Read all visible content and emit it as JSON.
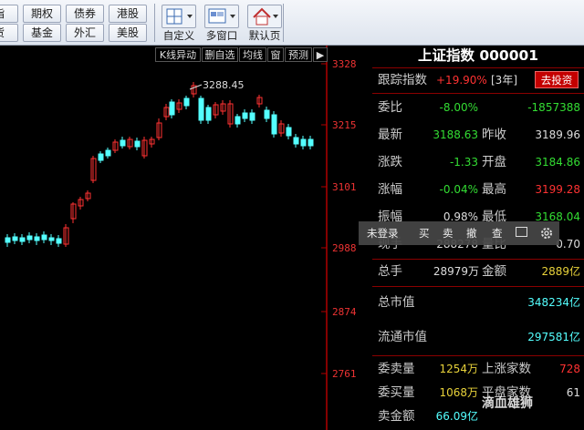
{
  "toolbar": {
    "row1": [
      "指",
      "期权",
      "债券",
      "港股"
    ],
    "row2": [
      "货",
      "基金",
      "外汇",
      "美股"
    ],
    "tools": [
      {
        "icon": "customize-grid-icon",
        "label": "自定义"
      },
      {
        "icon": "multi-window-icon",
        "label": "多窗口"
      },
      {
        "icon": "home-icon",
        "label": "默认页"
      }
    ]
  },
  "chart_tabs": [
    "K线异动",
    "删自选",
    "均线",
    "窗",
    "预测"
  ],
  "chart_tab_arrow": "▶",
  "chart_data": {
    "type": "candlestick",
    "y_ticks": [
      "3328",
      "3215",
      "3101",
      "2988",
      "2874",
      "2761"
    ],
    "ylim": [
      2761,
      3328
    ],
    "annotation": "3288.45",
    "up_color": "#ff3232",
    "down_color": "#54ffff"
  },
  "panel": {
    "title": "上证指数 000001",
    "track_label": "跟踪指数",
    "track_value": "+19.90%",
    "track_period": "[3年]",
    "invest_button": "去投资",
    "rows": [
      {
        "l1": "委比",
        "v1": "-8.00%",
        "c1": "#33dd33",
        "l2": "",
        "v2": "-1857388",
        "c2": "#33dd33"
      },
      {
        "l1": "最新",
        "v1": "3188.63",
        "c1": "#33dd33",
        "l2": "昨收",
        "v2": "3189.96",
        "c2": "#dddddd"
      },
      {
        "l1": "涨跌",
        "v1": "-1.33",
        "c1": "#33dd33",
        "l2": "开盘",
        "v2": "3184.86",
        "c2": "#33dd33"
      },
      {
        "l1": "涨幅",
        "v1": "-0.04%",
        "c1": "#33dd33",
        "l2": "最高",
        "v2": "3199.28",
        "c2": "#ff3232"
      },
      {
        "l1": "振幅",
        "v1": "0.98%",
        "c1": "#dddddd",
        "l2": "最低",
        "v2": "3168.04",
        "c2": "#33dd33"
      },
      {
        "l1": "现手",
        "v1": "288278",
        "c1": "#dddddd",
        "l2": "量比",
        "v2": "0.70",
        "c2": "#dddddd"
      }
    ],
    "total_hands_label": "总手",
    "total_hands_value": "28979万",
    "amount_label": "金额",
    "amount_value": "2889亿",
    "mcap_label": "总市值",
    "mcap_value": "348234亿",
    "float_label": "流通市值",
    "float_value": "297581亿",
    "sell_vol_label": "委卖量",
    "sell_vol_value": "1254万",
    "up_count_label": "上涨家数",
    "up_count_value": "728",
    "buy_vol_label": "委买量",
    "buy_vol_value": "1068万",
    "flat_count_label": "平盘家数",
    "flat_count_value": "61",
    "sell_amt_label": "卖金额",
    "sell_amt_value": "66.09亿"
  },
  "popup": {
    "login": "未登录",
    "actions": [
      "买",
      "卖",
      "撤",
      "查"
    ]
  },
  "watermark": "滴血雄狮"
}
